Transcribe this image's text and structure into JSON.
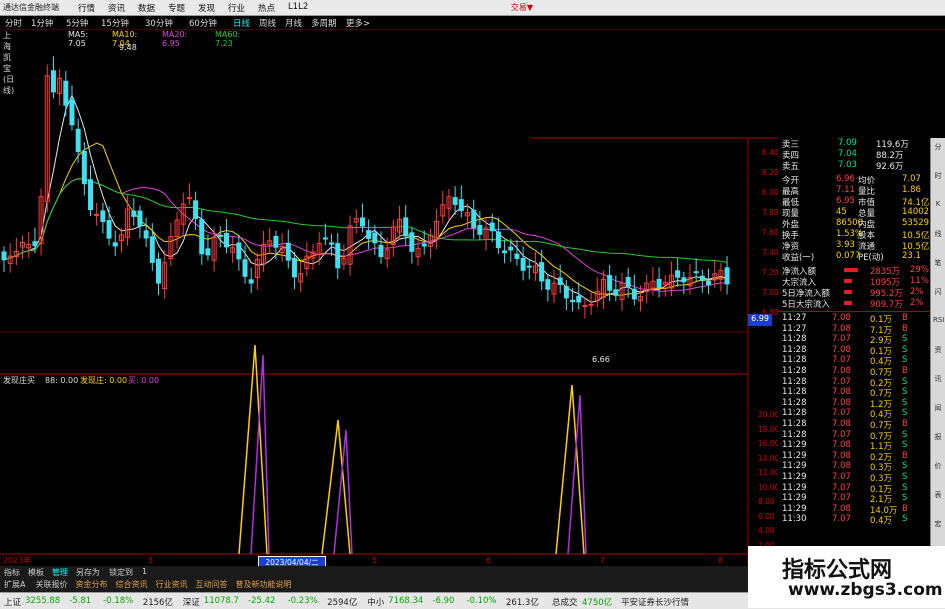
{
  "app": {
    "title": "通达信金融终端",
    "menu": [
      "行情",
      "资讯",
      "数据",
      "专题",
      "发现",
      "行业",
      "热点",
      "L1L2"
    ],
    "right": "交易▼"
  },
  "periods": [
    {
      "label": "分时",
      "active": false
    },
    {
      "label": "1分钟",
      "active": false
    },
    {
      "label": "5分钟",
      "active": false
    },
    {
      "label": "15分钟",
      "active": false
    },
    {
      "label": "30分钟",
      "active": false
    },
    {
      "label": "60分钟",
      "active": false
    },
    {
      "label": "日线",
      "active": true
    },
    {
      "label": "周线",
      "active": false
    },
    {
      "label": "月线",
      "active": false
    },
    {
      "label": "多周期",
      "active": false
    },
    {
      "label": "更多>",
      "active": false
    }
  ],
  "ma_legend": {
    "stock": "上海凯宝(日线)",
    "ma5": "MA5: 7.05",
    "ma10": "MA10: 7.04",
    "ma20": "MA20: 6.95",
    "ma60": "MA60: 7.23",
    "ma5_color": "#e8e8e8",
    "ma10_color": "#ffd000",
    "ma20_color": "#e040e0",
    "ma60_color": "#20d020"
  },
  "price_labels": {
    "high": "9.48",
    "low": "6.66",
    "current": "6.99"
  },
  "price_axis": [
    "8.40",
    "8.20",
    "8.00",
    "7.80",
    "7.60",
    "7.40",
    "7.20",
    "7.00",
    "6.80"
  ],
  "indicator": {
    "legend_name": "发现庄买",
    "legend_value": "88: 0.00",
    "legend_yellow": "发现庄: 0.00",
    "legend_mag": "买: 0.00",
    "axis": [
      "20.00",
      "18.00",
      "16.00",
      "14.00",
      "12.00",
      "10.00",
      "8.00",
      "6.00",
      "4.00",
      "2.00"
    ]
  },
  "date_axis": {
    "year": "2023年",
    "date_box": "2023/04/04/二",
    "months": [
      "3",
      "4",
      "5",
      "6",
      "7",
      "8"
    ]
  },
  "quote": {
    "rows": [
      {
        "l": "卖三",
        "p": "7.09",
        "v": "119.6万"
      },
      {
        "l": "卖四",
        "p": "7.04",
        "v": "88.2万"
      },
      {
        "l": "卖五",
        "p": "7.03",
        "v": "92.6万"
      }
    ],
    "stats": [
      [
        "今开",
        "6.96",
        "均价",
        "7.07"
      ],
      [
        "最高",
        "7.11",
        "量比",
        "1.86"
      ],
      [
        "最低",
        "6.95",
        "市值",
        "74.1亿"
      ],
      [
        "现量",
        "45",
        "总量",
        "14002"
      ],
      [
        "外盘",
        "86500",
        "内盘",
        "53529"
      ],
      [
        "换手",
        "1.53%",
        "股本",
        "10.5亿"
      ],
      [
        "净资",
        "3.93",
        "流通",
        "10.5亿"
      ],
      [
        "收益(一)",
        "0.077",
        "PE(动)",
        "23.1"
      ]
    ],
    "flows": [
      {
        "label": "净流入额",
        "val": "2835万",
        "pct": "29%"
      },
      {
        "label": "大宗流入",
        "val": "1095万",
        "pct": "11%"
      },
      {
        "label": "5日净流入额",
        "val": "995.2万",
        "pct": "2%"
      },
      {
        "label": "5日大宗流入",
        "val": "909.7万",
        "pct": "2%"
      }
    ]
  },
  "ticks": [
    [
      "11:27",
      "7.08",
      "0.1万",
      "B"
    ],
    [
      "11:27",
      "7.08",
      "7.1万",
      "B"
    ],
    [
      "11:28",
      "7.07",
      "2.9万",
      "S"
    ],
    [
      "11:28",
      "7.08",
      "0.1万",
      "S"
    ],
    [
      "11:28",
      "7.07",
      "0.4万",
      "S"
    ],
    [
      "11:28",
      "7.08",
      "0.7万",
      "B"
    ],
    [
      "11:28",
      "7.07",
      "0.2万",
      "S"
    ],
    [
      "11:28",
      "7.08",
      "0.7万",
      "S"
    ],
    [
      "11:28",
      "7.08",
      "1.2万",
      "S"
    ],
    [
      "11:28",
      "7.07",
      "0.4万",
      "S"
    ],
    [
      "11:28",
      "7.08",
      "0.7万",
      "B"
    ],
    [
      "11:28",
      "7.07",
      "0.7万",
      "S"
    ],
    [
      "11:29",
      "7.08",
      "1.1万",
      "S"
    ],
    [
      "11:29",
      "7.08",
      "0.2万",
      "B"
    ],
    [
      "11:29",
      "7.08",
      "0.3万",
      "S"
    ],
    [
      "11:29",
      "7.07",
      "0.3万",
      "S"
    ],
    [
      "11:29",
      "7.07",
      "0.1万",
      "S"
    ],
    [
      "11:29",
      "7.07",
      "2.1万",
      "S"
    ],
    [
      "11:29",
      "7.08",
      "14.0万",
      "B"
    ],
    [
      "11:30",
      "7.07",
      "0.4万",
      "S"
    ]
  ],
  "bottom_tabs": [
    "指标",
    "模板",
    "管理",
    "另存为",
    "锁定到",
    "1"
  ],
  "bottom_links": [
    "扩展A",
    "关联报价",
    "资金分布",
    "综合资讯",
    "行业资讯",
    "互动问答",
    "普及新功能说明"
  ],
  "indexes": [
    {
      "name": "上证",
      "val": "3255.88",
      "chg": "-5.81",
      "pct": "-0.18%",
      "amt": "2156亿"
    },
    {
      "name": "深证",
      "val": "11078.7",
      "chg": "-25.42",
      "pct": "-0.23%",
      "amt": "2594亿"
    },
    {
      "name": "中小",
      "val": "7168.34",
      "chg": "-6.90",
      "pct": "-0.10%",
      "amt": "261.3亿"
    },
    {
      "name": "总成交",
      "val": "4750亿",
      "chg": "",
      "pct": "",
      "amt": ""
    }
  ],
  "broker": "平安证券长沙行情",
  "watermark": {
    "line1": "指标公式网",
    "line2": "www.zbgs3.com"
  },
  "sidebar": [
    "分",
    "时",
    "K",
    "线",
    "笔",
    "闪",
    "RSI",
    "资",
    "讯",
    "闻",
    "报",
    "价",
    "表",
    "宏"
  ]
}
